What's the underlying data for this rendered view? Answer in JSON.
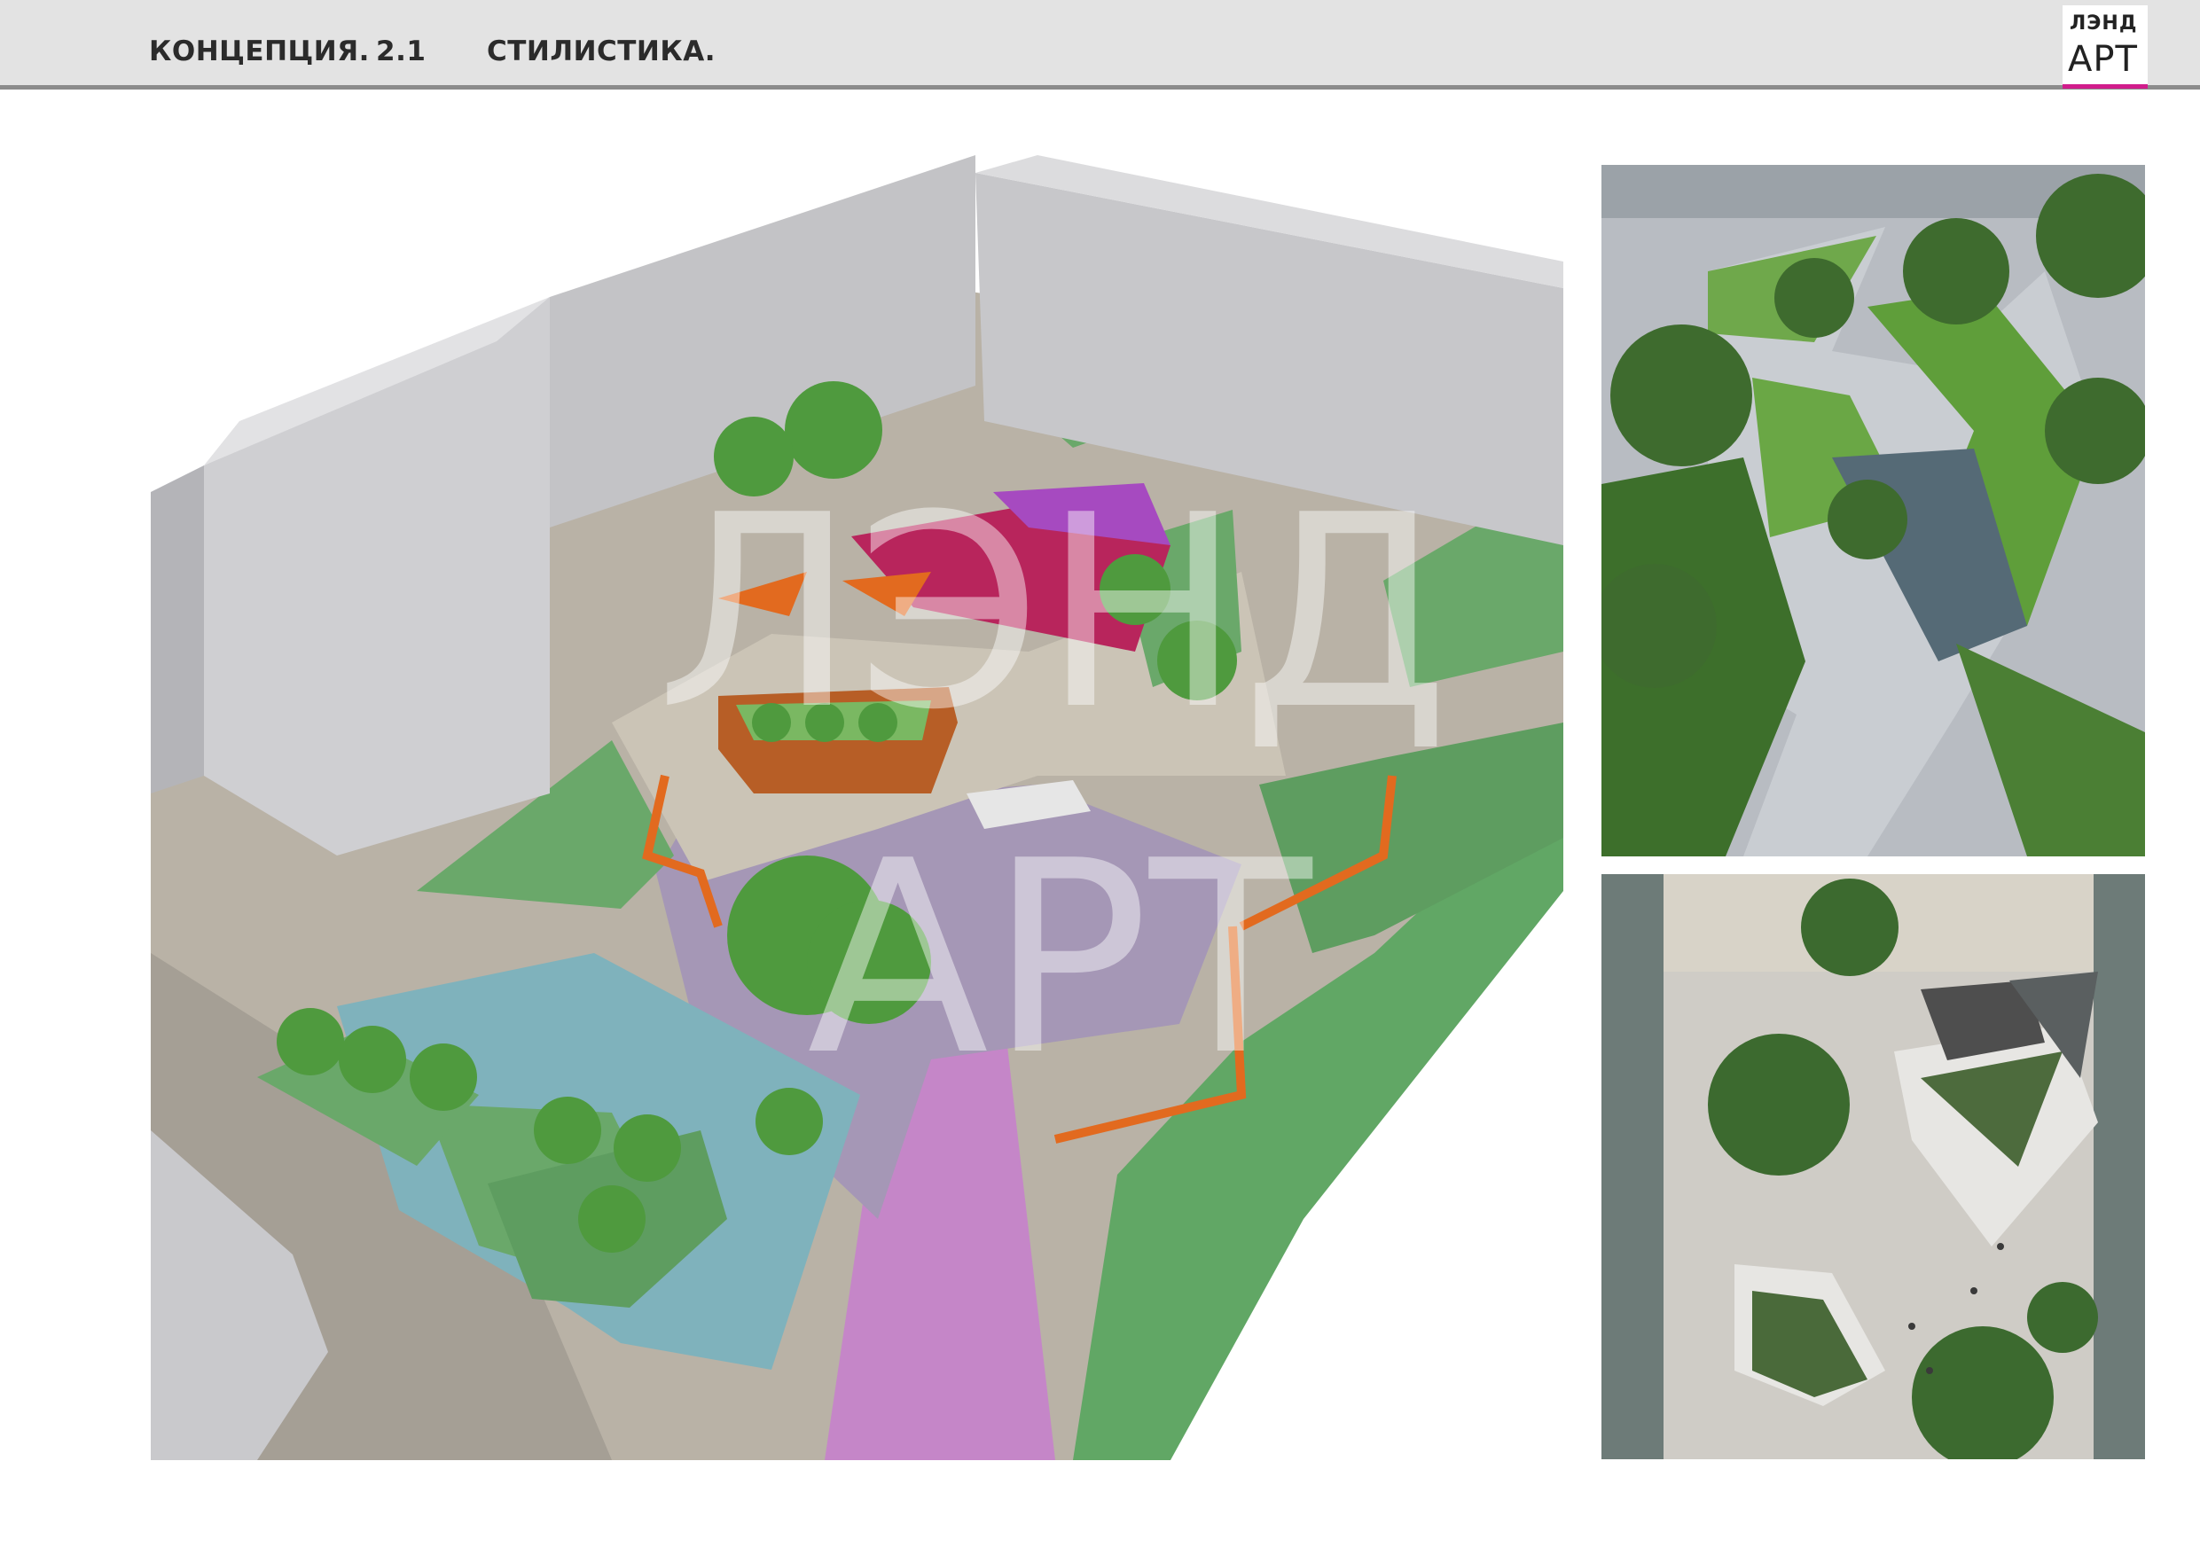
{
  "header": {
    "section": "КОНЦЕПЦИЯ.",
    "number": "2.1",
    "subtitle": "СТИЛИСТИКА."
  },
  "logo": {
    "line1": "ЛЭНД",
    "line2": "АРТ",
    "accent_color": "#d11d8c"
  },
  "watermark": {
    "line1": "ЛЭНД",
    "line2": "АРТ"
  }
}
